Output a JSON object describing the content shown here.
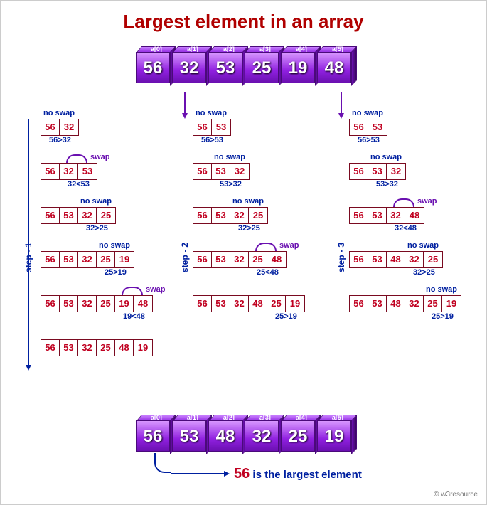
{
  "title": "Largest element in an array",
  "credit": "© w3resource",
  "indices": [
    "a[0]",
    "a[1]",
    "a[2]",
    "a[3]",
    "a[4]",
    "a[5]"
  ],
  "top_array": [
    "56",
    "32",
    "53",
    "25",
    "19",
    "48"
  ],
  "bottom_array": [
    "56",
    "53",
    "48",
    "32",
    "25",
    "19"
  ],
  "final_text": {
    "value": "56",
    "rest": " is the largest element"
  },
  "labels": {
    "no_swap": "no swap",
    "swap": "swap",
    "step1": "step - 1",
    "step2": "step - 2",
    "step3": "step - 3"
  },
  "step1": {
    "rows": [
      {
        "cells": [
          "56",
          "32"
        ],
        "cmp": "56>32",
        "tag": "no_swap"
      },
      {
        "cells": [
          "56",
          "32",
          "53"
        ],
        "cmp": "32<53",
        "tag": "swap"
      },
      {
        "cells": [
          "56",
          "53",
          "32",
          "25"
        ],
        "cmp": "32>25",
        "tag": "no_swap"
      },
      {
        "cells": [
          "56",
          "53",
          "32",
          "25",
          "19"
        ],
        "cmp": "25>19",
        "tag": "no_swap"
      },
      {
        "cells": [
          "56",
          "53",
          "32",
          "25",
          "19",
          "48"
        ],
        "cmp": "19<48",
        "tag": "swap"
      },
      {
        "cells": [
          "56",
          "53",
          "32",
          "25",
          "48",
          "19"
        ],
        "cmp": "",
        "tag": ""
      }
    ]
  },
  "step2": {
    "rows": [
      {
        "cells": [
          "56",
          "53"
        ],
        "cmp": "56>53",
        "tag": "no_swap"
      },
      {
        "cells": [
          "56",
          "53",
          "32"
        ],
        "cmp": "53>32",
        "tag": "no_swap"
      },
      {
        "cells": [
          "56",
          "53",
          "32",
          "25"
        ],
        "cmp": "32>25",
        "tag": "no_swap"
      },
      {
        "cells": [
          "56",
          "53",
          "32",
          "25",
          "48"
        ],
        "cmp": "25<48",
        "tag": "swap"
      },
      {
        "cells": [
          "56",
          "53",
          "32",
          "48",
          "25",
          "19"
        ],
        "cmp": "25>19",
        "tag": ""
      }
    ]
  },
  "step3": {
    "rows": [
      {
        "cells": [
          "56",
          "53"
        ],
        "cmp": "56>53",
        "tag": "no_swap"
      },
      {
        "cells": [
          "56",
          "53",
          "32"
        ],
        "cmp": "53>32",
        "tag": "no_swap"
      },
      {
        "cells": [
          "56",
          "53",
          "32",
          "48"
        ],
        "cmp": "32<48",
        "tag": "swap"
      },
      {
        "cells": [
          "56",
          "53",
          "48",
          "32",
          "25"
        ],
        "cmp": "32>25",
        "tag": "no_swap"
      },
      {
        "cells": [
          "56",
          "53",
          "48",
          "32",
          "25",
          "19"
        ],
        "cmp": "25>19",
        "tag": "no_swap"
      }
    ]
  }
}
